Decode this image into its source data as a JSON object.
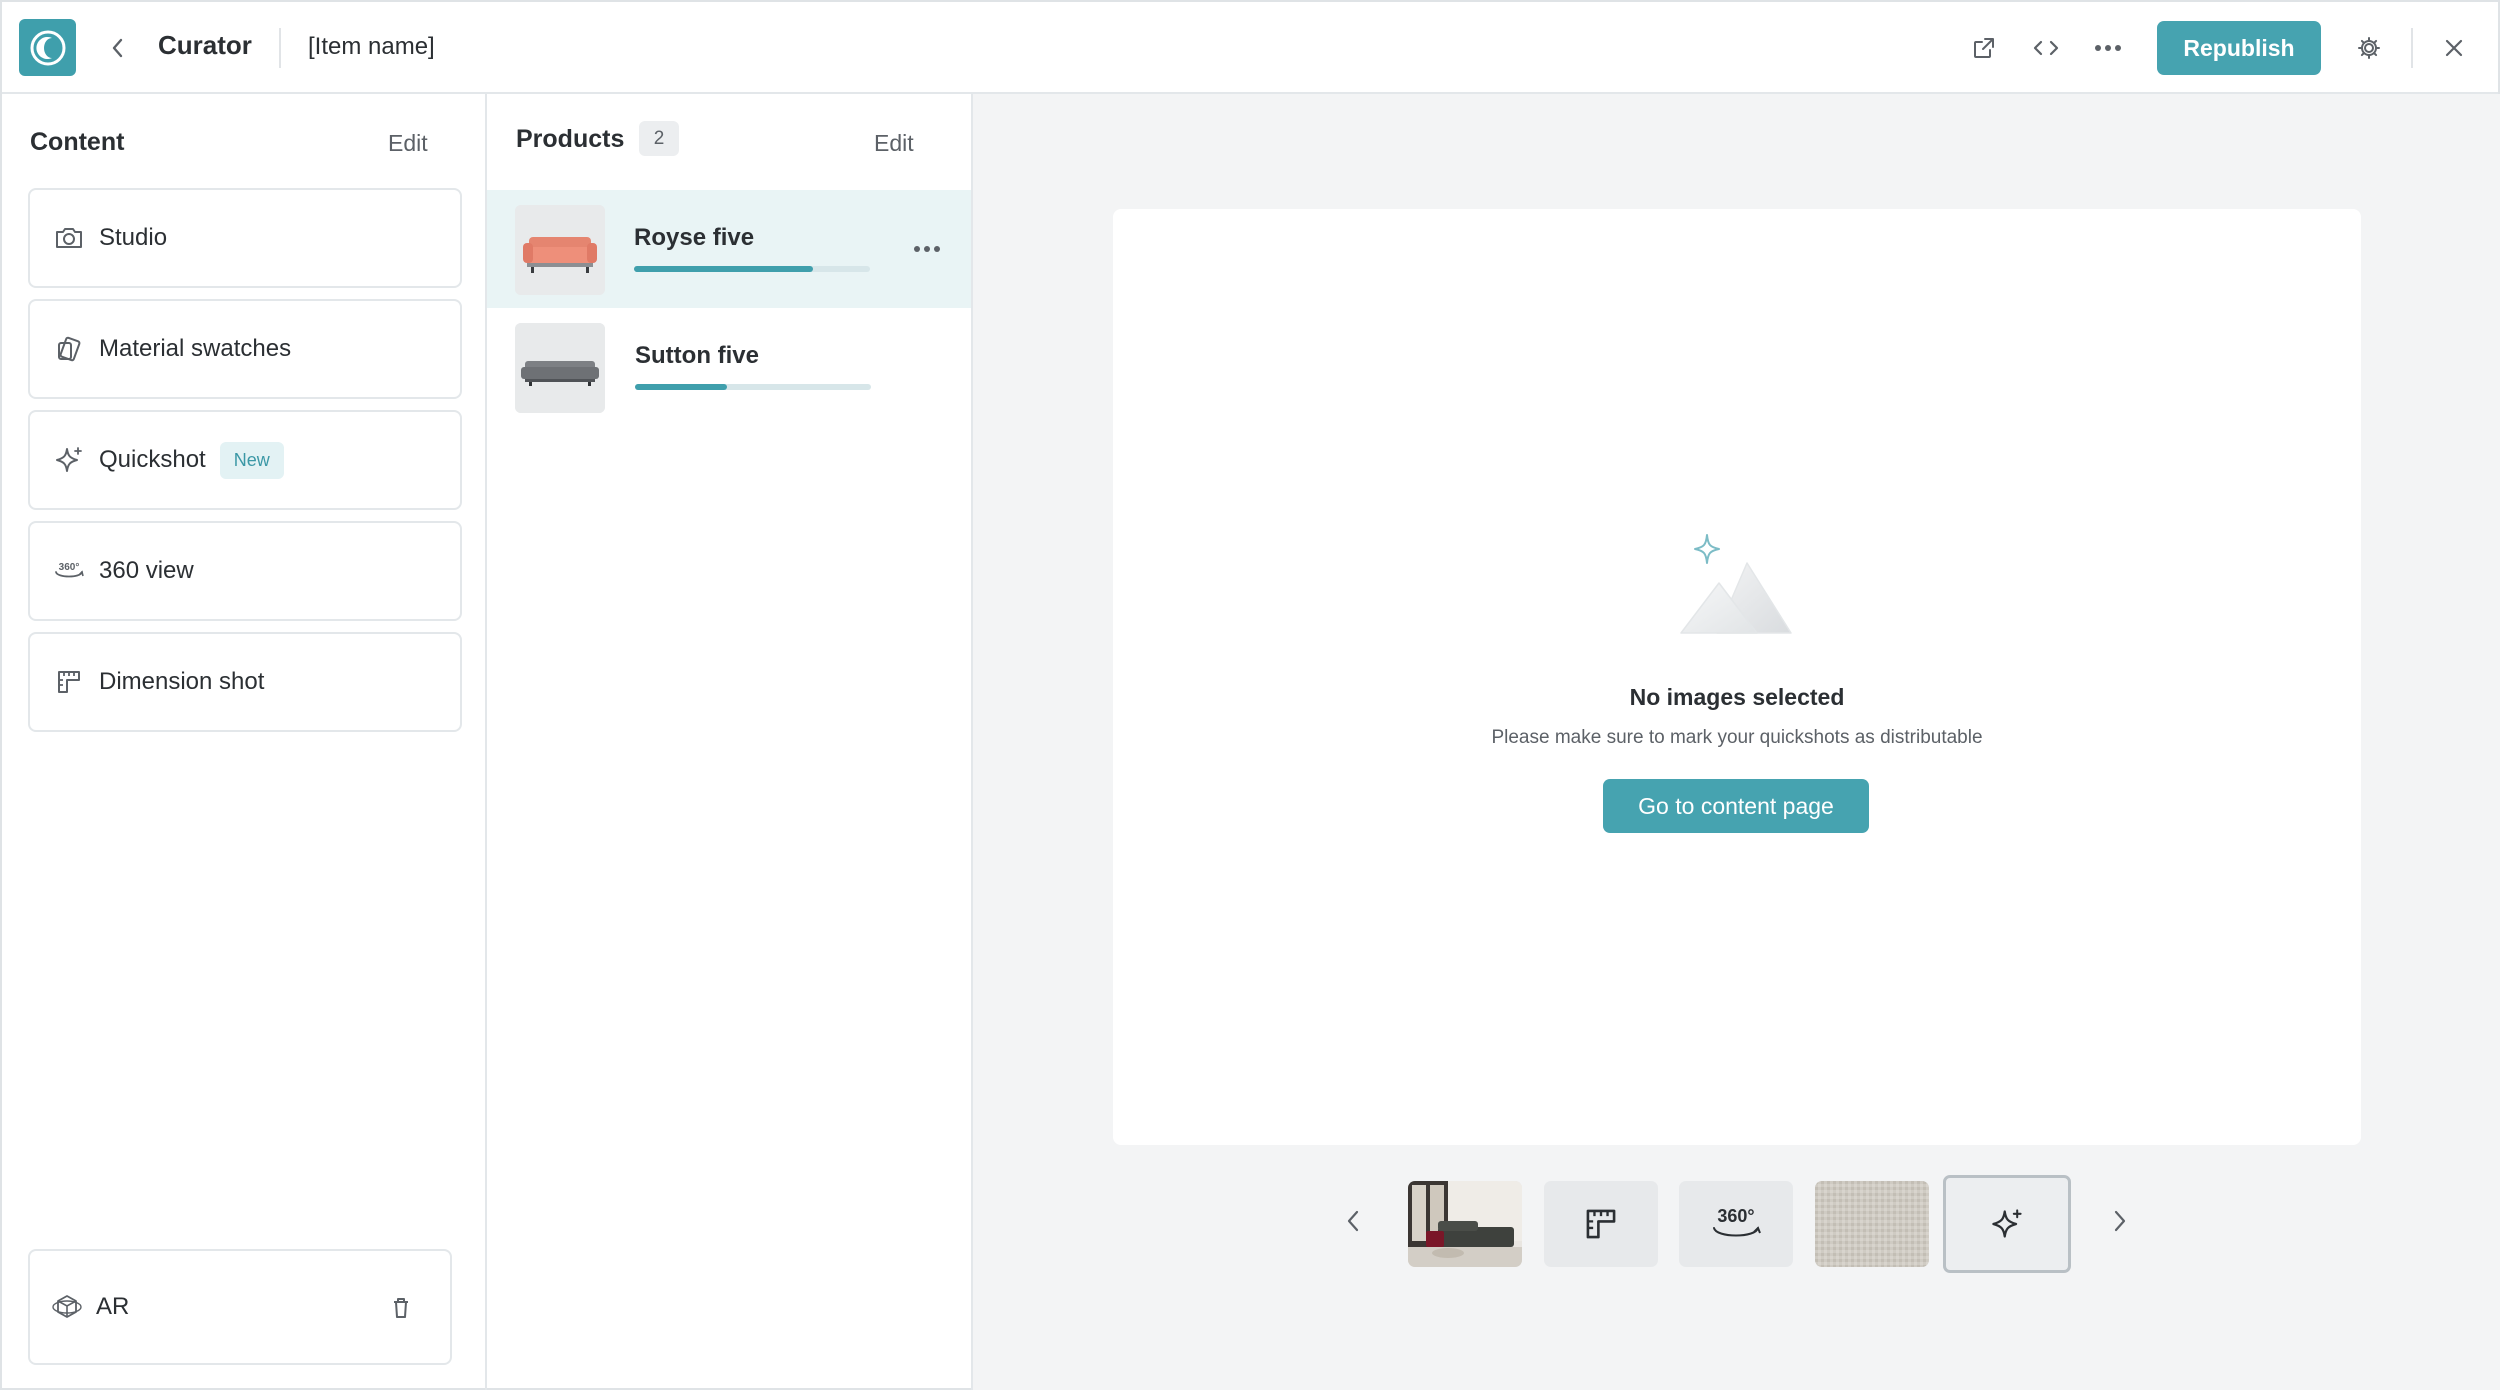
{
  "header": {
    "app_title": "Curator",
    "item_name": "[Item name]",
    "republish_label": "Republish",
    "icons": [
      "logo-icon",
      "back-icon",
      "external-link-icon",
      "code-icon",
      "more-icon",
      "settings-icon",
      "close-icon"
    ]
  },
  "content": {
    "title": "Content",
    "edit_label": "Edit",
    "items": [
      {
        "label": "Studio",
        "icon": "camera-icon"
      },
      {
        "label": "Material swatches",
        "icon": "swatch-icon"
      },
      {
        "label": "Quickshot",
        "icon": "sparkle-icon",
        "badge": "New"
      },
      {
        "label": "360 view",
        "icon": "360-icon"
      },
      {
        "label": "Dimension shot",
        "icon": "ruler-icon"
      }
    ],
    "ar": {
      "label": "AR",
      "icon": "ar-icon"
    }
  },
  "products": {
    "title": "Products",
    "count": "2",
    "edit_label": "Edit",
    "items": [
      {
        "name": "Royse five",
        "progress": 0.76,
        "selected": true
      },
      {
        "name": "Sutton five",
        "progress": 0.39,
        "selected": false
      }
    ]
  },
  "preview": {
    "empty_title": "No images selected",
    "empty_subtitle": "Please make sure to mark your quickshots as distributable",
    "cta_label": "Go to content page",
    "strip": {
      "thumb_360_label": "360°",
      "items": [
        "studio-photo",
        "dimension",
        "360",
        "material-swatch",
        "quickshot"
      ],
      "active_index": 4
    }
  },
  "colors": {
    "accent": "#46a3b0",
    "accent_light": "#e3f2f4",
    "selected_row": "#e9f4f5",
    "preview_bg": "#f3f4f5",
    "border": "#e3e7ea"
  }
}
